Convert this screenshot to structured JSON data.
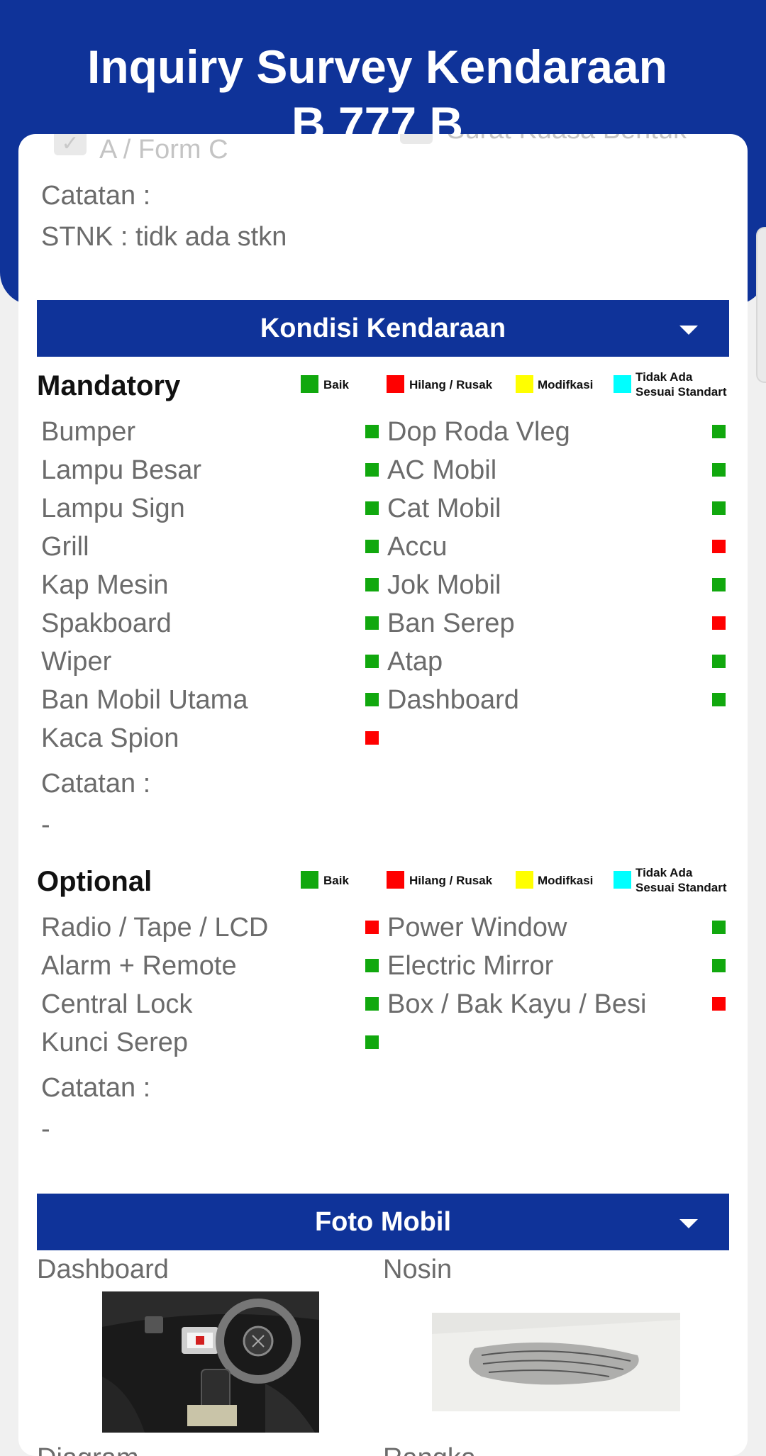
{
  "header": {
    "title_line1": "Inquiry Survey Kendaraan",
    "title_line2": "B 777 B"
  },
  "documents": {
    "left_partial_text": "A / Form C",
    "right_partial_text": "Surat Kuasa Bentuk",
    "note_label": "Catatan :",
    "stnk_note": "STNK : tidk ada stkn"
  },
  "kondisi": {
    "section_title": "Kondisi Kendaraan",
    "legend": {
      "good": "Baik",
      "lost_broken": "Hilang / Rusak",
      "modified": "Modifkasi",
      "not_standard_line1": "Tidak Ada",
      "not_standard_line2": "Sesuai Standart"
    },
    "colors": {
      "good": "#11a80e",
      "lost_broken": "#ff0000",
      "modified": "#ffff00",
      "not_standard": "#00ffff"
    },
    "mandatory": {
      "title": "Mandatory",
      "left": [
        {
          "label": "Bumper",
          "status": "good"
        },
        {
          "label": "Lampu Besar",
          "status": "good"
        },
        {
          "label": "Lampu Sign",
          "status": "good"
        },
        {
          "label": "Grill",
          "status": "good"
        },
        {
          "label": "Kap Mesin",
          "status": "good"
        },
        {
          "label": "Spakboard",
          "status": "good"
        },
        {
          "label": "Wiper",
          "status": "good"
        },
        {
          "label": "Ban Mobil Utama",
          "status": "good"
        },
        {
          "label": "Kaca Spion",
          "status": "lost_broken"
        }
      ],
      "right": [
        {
          "label": "Dop Roda Vleg",
          "status": "good"
        },
        {
          "label": "AC Mobil",
          "status": "good"
        },
        {
          "label": "Cat Mobil",
          "status": "good"
        },
        {
          "label": "Accu",
          "status": "lost_broken"
        },
        {
          "label": "Jok Mobil",
          "status": "good"
        },
        {
          "label": "Ban Serep",
          "status": "lost_broken"
        },
        {
          "label": "Atap",
          "status": "good"
        },
        {
          "label": "Dashboard",
          "status": "good"
        }
      ],
      "note_label": "Catatan :",
      "note_value": "-"
    },
    "optional": {
      "title": "Optional",
      "left": [
        {
          "label": "Radio / Tape / LCD",
          "status": "lost_broken"
        },
        {
          "label": "Alarm + Remote",
          "status": "good"
        },
        {
          "label": "Central Lock",
          "status": "good"
        },
        {
          "label": "Kunci Serep",
          "status": "good"
        }
      ],
      "right": [
        {
          "label": "Power Window",
          "status": "good"
        },
        {
          "label": "Electric Mirror",
          "status": "good"
        },
        {
          "label": "Box / Bak Kayu / Besi",
          "status": "lost_broken"
        }
      ],
      "note_label": "Catatan :",
      "note_value": "-"
    }
  },
  "foto": {
    "section_title": "Foto Mobil",
    "photos": [
      {
        "label": "Dashboard"
      },
      {
        "label": "Nosin"
      },
      {
        "label": "Diagram"
      },
      {
        "label": "Rangka"
      }
    ]
  }
}
